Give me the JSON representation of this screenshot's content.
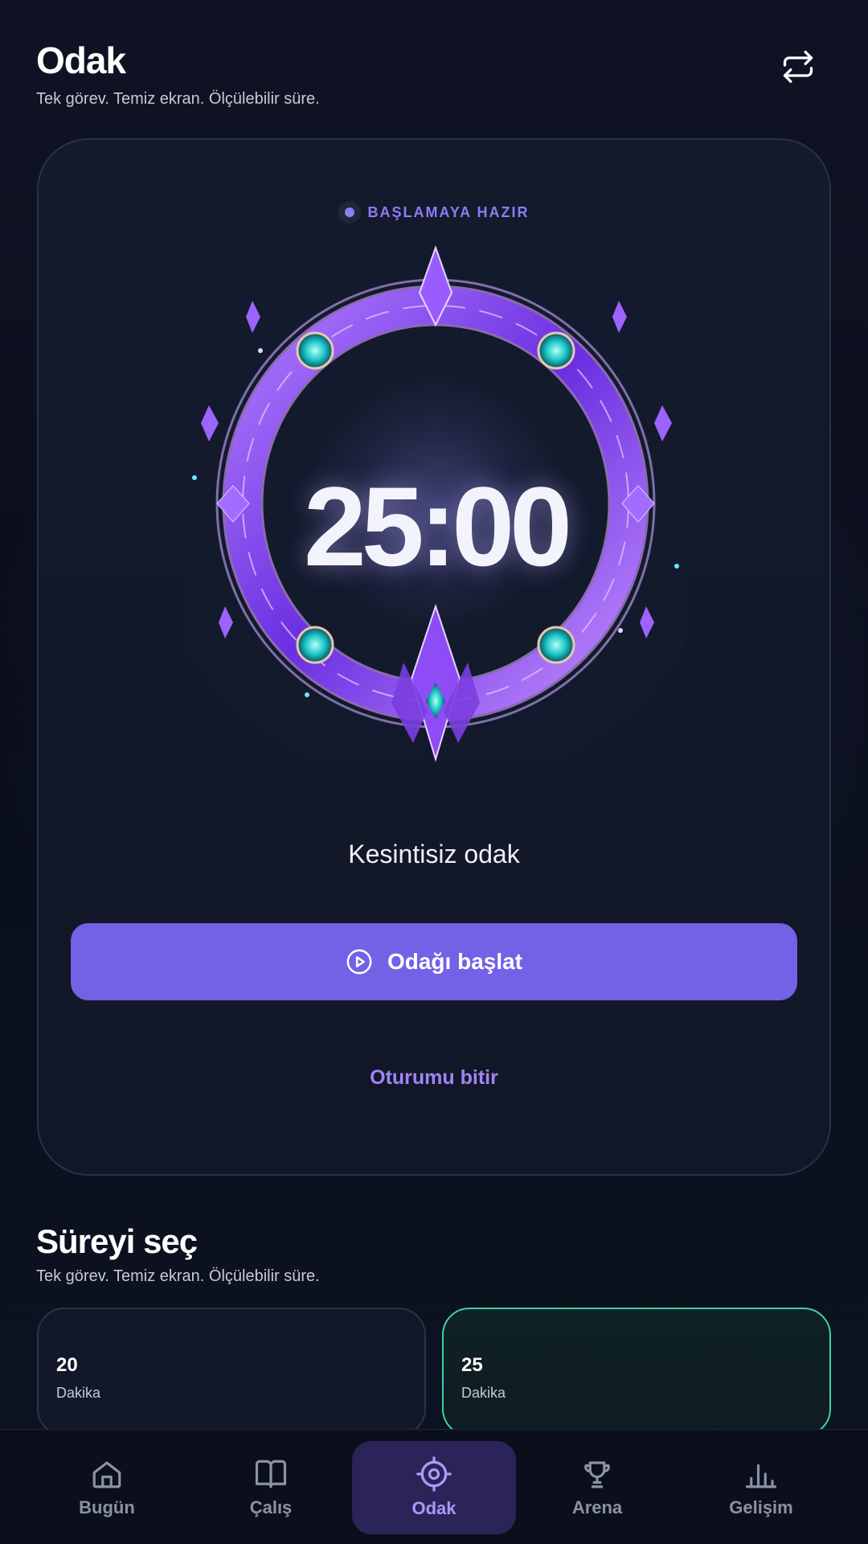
{
  "header": {
    "title": "Odak",
    "subtitle": "Tek görev. Temiz ekran. Ölçülebilir süre.",
    "swap_icon": "swap-arrows-icon"
  },
  "focus_card": {
    "status": "BAŞLAMAYA HAZIR",
    "timer": "25:00",
    "mode": "Kesintisiz odak",
    "start_button": "Odağı başlat",
    "end_link": "Oturumu bitir"
  },
  "duration_section": {
    "title": "Süreyi seç",
    "subtitle": "Tek görev. Temiz ekran. Ölçülebilir süre.",
    "options": [
      {
        "value": "20",
        "unit": "Dakika",
        "selected": false
      },
      {
        "value": "25",
        "unit": "Dakika",
        "selected": true
      }
    ]
  },
  "nav": {
    "items": [
      {
        "label": "Bugün",
        "icon": "home-icon"
      },
      {
        "label": "Çalış",
        "icon": "book-icon"
      },
      {
        "label": "Odak",
        "icon": "target-icon",
        "active": true
      },
      {
        "label": "Arena",
        "icon": "trophy-icon"
      },
      {
        "label": "Gelişim",
        "icon": "bar-chart-icon"
      }
    ]
  },
  "colors": {
    "accent": "#7361e6",
    "accent_text": "#a184f5",
    "selected_border": "#3ed2a2"
  }
}
